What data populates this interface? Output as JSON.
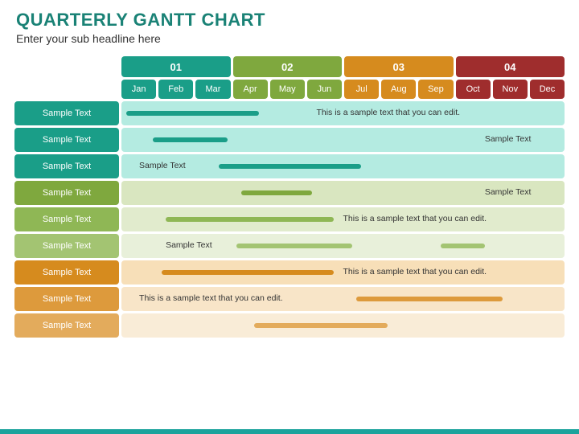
{
  "title": "QUARTERLY GANTT CHART",
  "subtitle": "Enter your sub headline here",
  "quarters": [
    {
      "label": "01",
      "bg": "#1a9e88",
      "months": [
        "Jan",
        "Feb",
        "Mar"
      ],
      "mbg": "#1a9e88"
    },
    {
      "label": "02",
      "bg": "#7fa83e",
      "months": [
        "Apr",
        "May",
        "Jun"
      ],
      "mbg": "#7fa83e"
    },
    {
      "label": "03",
      "bg": "#d68b1e",
      "months": [
        "Jul",
        "Aug",
        "Sep"
      ],
      "mbg": "#d68b1e"
    },
    {
      "label": "04",
      "bg": "#9f2d2d",
      "months": [
        "Oct",
        "Nov",
        "Dec"
      ],
      "mbg": "#9f2d2d"
    }
  ],
  "rows": [
    {
      "label": "Sample Text",
      "labelBg": "#1a9e88",
      "trackBg": "#b4ebe1",
      "bars": [
        {
          "start": 1,
          "end": 31,
          "color": "#1a9e88"
        }
      ],
      "text": "This is a sample text that you can edit.",
      "textPos": 44
    },
    {
      "label": "Sample Text",
      "labelBg": "#1a9e88",
      "trackBg": "#b4ebe1",
      "bars": [
        {
          "start": 7,
          "end": 24,
          "color": "#1a9e88"
        }
      ],
      "text": "Sample Text",
      "textPos": 82
    },
    {
      "label": "Sample Text",
      "labelBg": "#1a9e88",
      "trackBg": "#b4ebe1",
      "bars": [
        {
          "start": 22,
          "end": 54,
          "color": "#1a9e88"
        }
      ],
      "text": "Sample Text",
      "textPos": 4
    },
    {
      "label": "Sample Text",
      "labelBg": "#7fa83e",
      "trackBg": "#d9e6c0",
      "bars": [
        {
          "start": 27,
          "end": 43,
          "color": "#7fa83e"
        }
      ],
      "text": "Sample Text",
      "textPos": 82
    },
    {
      "label": "Sample Text",
      "labelBg": "#8fb755",
      "trackBg": "#e1ebcd",
      "bars": [
        {
          "start": 10,
          "end": 48,
          "color": "#8fb755"
        }
      ],
      "text": "This is a sample text that you can edit.",
      "textPos": 50
    },
    {
      "label": "Sample Text",
      "labelBg": "#a3c472",
      "trackBg": "#e8f0da",
      "bars": [
        {
          "start": 26,
          "end": 52,
          "color": "#a3c472"
        },
        {
          "start": 72,
          "end": 82,
          "color": "#a3c472"
        }
      ],
      "text": "Sample Text",
      "textPos": 10
    },
    {
      "label": "Sample Text",
      "labelBg": "#d68b1e",
      "trackBg": "#f7dfb8",
      "bars": [
        {
          "start": 9,
          "end": 48,
          "color": "#d68b1e"
        }
      ],
      "text": "This is a sample text that you can edit.",
      "textPos": 50
    },
    {
      "label": "Sample Text",
      "labelBg": "#dd9a3c",
      "trackBg": "#f8e5c8",
      "bars": [
        {
          "start": 53,
          "end": 86,
          "color": "#dd9a3c"
        }
      ],
      "text": "This is a sample text that you can edit.",
      "textPos": 4
    },
    {
      "label": "Sample Text",
      "labelBg": "#e3ab5c",
      "trackBg": "#f9ecd7",
      "bars": [
        {
          "start": 30,
          "end": 60,
          "color": "#e3ab5c"
        }
      ],
      "text": "",
      "textPos": 0
    }
  ],
  "chart_data": {
    "type": "gantt",
    "title": "Quarterly Gantt Chart",
    "x_axis": {
      "unit": "month",
      "categories": [
        "Jan",
        "Feb",
        "Mar",
        "Apr",
        "May",
        "Jun",
        "Jul",
        "Aug",
        "Sep",
        "Oct",
        "Nov",
        "Dec"
      ],
      "quarters": [
        "01",
        "02",
        "03",
        "04"
      ]
    },
    "tasks": [
      {
        "name": "Sample Text",
        "group": "Q1",
        "start_month": 1.1,
        "end_month": 4.7,
        "annotation": "This is a sample text that you can edit."
      },
      {
        "name": "Sample Text",
        "group": "Q1",
        "start_month": 1.9,
        "end_month": 3.9,
        "annotation": "Sample Text"
      },
      {
        "name": "Sample Text",
        "group": "Q1",
        "start_month": 3.7,
        "end_month": 7.5,
        "annotation": "Sample Text"
      },
      {
        "name": "Sample Text",
        "group": "Q2",
        "start_month": 4.3,
        "end_month": 6.2,
        "annotation": "Sample Text"
      },
      {
        "name": "Sample Text",
        "group": "Q2",
        "start_month": 2.2,
        "end_month": 6.8,
        "annotation": "This is a sample text that you can edit."
      },
      {
        "name": "Sample Text",
        "group": "Q2",
        "segments": [
          {
            "start_month": 4.1,
            "end_month": 7.3
          },
          {
            "start_month": 9.7,
            "end_month": 10.9
          }
        ],
        "annotation": "Sample Text"
      },
      {
        "name": "Sample Text",
        "group": "Q3",
        "start_month": 2.1,
        "end_month": 6.8,
        "annotation": "This is a sample text that you can edit."
      },
      {
        "name": "Sample Text",
        "group": "Q3",
        "start_month": 7.4,
        "end_month": 11.4,
        "annotation": "This is a sample text that you can edit."
      },
      {
        "name": "Sample Text",
        "group": "Q3",
        "start_month": 4.6,
        "end_month": 8.2,
        "annotation": ""
      }
    ]
  }
}
